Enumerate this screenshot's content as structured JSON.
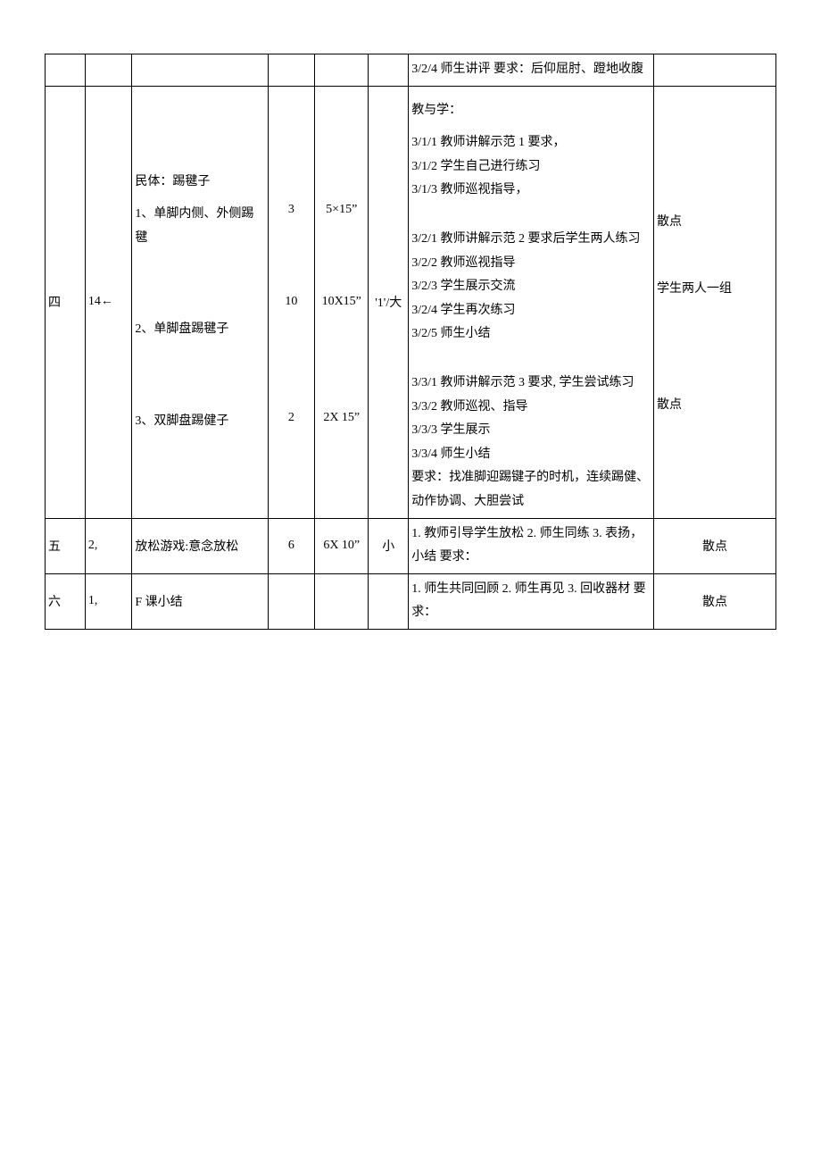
{
  "row_top": {
    "teach": "3/2/4 师生讲评\n要求：后仰屈肘、蹬地收腹"
  },
  "row4": {
    "num": "四",
    "time": "14←",
    "activity": {
      "title": "民体：踢毽子",
      "parts": [
        "1、单脚内侧、外侧踢毽",
        "2、单脚盘踢毽子",
        "3、双脚盘踢健子"
      ]
    },
    "reps": [
      "3",
      "10",
      "2"
    ],
    "dur": [
      "5×15”",
      "10X15”",
      "2X 15”"
    ],
    "intensity": "'1'/大",
    "teach": {
      "header": "教与学：",
      "p1": [
        "3/1/1 教师讲解示范 1 要求，",
        "3/1/2 学生自己进行练习",
        "3/1/3 教师巡视指导，"
      ],
      "p2": [
        "3/2/1 教师讲解示范 2 要求后学生两人练习",
        "3/2/2 教师巡视指导",
        "3/2/3 学生展示交流",
        "3/2/4 学生再次练习",
        "3/2/5 师生小结"
      ],
      "p3": [
        "3/3/1 教师讲解示范 3 要求, 学生尝试练习",
        "3/3/2 教师巡视、指导",
        "3/3/3 学生展示",
        "3/3/4 师生小结",
        "要求：找准脚迎踢键子的时机，连续踢健、动作协调、大胆尝试"
      ]
    },
    "formation": {
      "f1": "散点",
      "f2": "学生两人一组",
      "f3": "散点"
    }
  },
  "row5": {
    "num": "五",
    "time": "2,",
    "activity": "放松游戏:意念放松",
    "reps": "6",
    "dur": "6X 10”",
    "intensity": "小",
    "teach": "1. 教师引导学生放松      2. 师生同练 3. 表扬， 小结\n要求：",
    "formation": "散点"
  },
  "row6": {
    "num": "六",
    "time": "1,",
    "activity": "F 课小结",
    "teach": "1. 师生共同回顾 2. 师生再见 3. 回收器材\n要求：",
    "formation": "散点"
  }
}
